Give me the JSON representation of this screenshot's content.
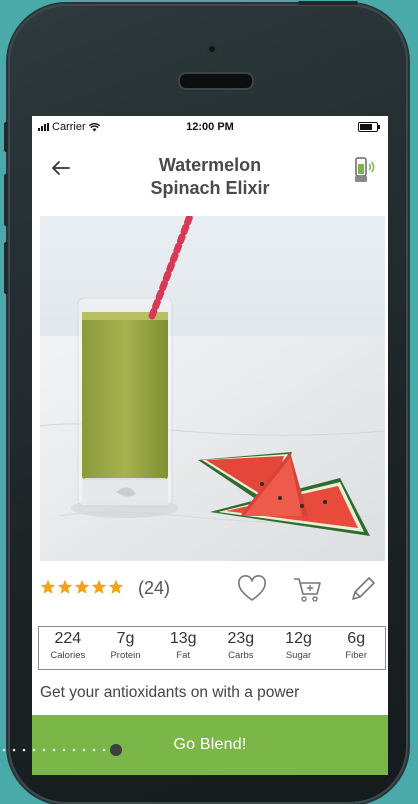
{
  "status": {
    "carrier": "Carrier",
    "time": "12:00 PM"
  },
  "recipe": {
    "title_line1": "Watermelon",
    "title_line2": "Spinach Elixir",
    "rating": 5,
    "rating_count": "(24)",
    "description": "Get your antioxidants on with a power"
  },
  "nutrition": [
    {
      "value": "224",
      "label": "Calories"
    },
    {
      "value": "7g",
      "label": "Protein"
    },
    {
      "value": "13g",
      "label": "Fat"
    },
    {
      "value": "23g",
      "label": "Carbs"
    },
    {
      "value": "12g",
      "label": "Sugar"
    },
    {
      "value": "6g",
      "label": "Fiber"
    }
  ],
  "cta": {
    "label": "Go Blend!"
  },
  "icons": {
    "back": "back-arrow-icon",
    "blender": "blender-connect-icon",
    "favorite": "heart-icon",
    "cart": "add-to-cart-icon",
    "edit": "pencil-icon",
    "star": "star-icon"
  },
  "colors": {
    "background": "#4aa9a9",
    "accent_green": "#7ab648",
    "star": "#f0a31c",
    "title": "#4a4a4a"
  }
}
